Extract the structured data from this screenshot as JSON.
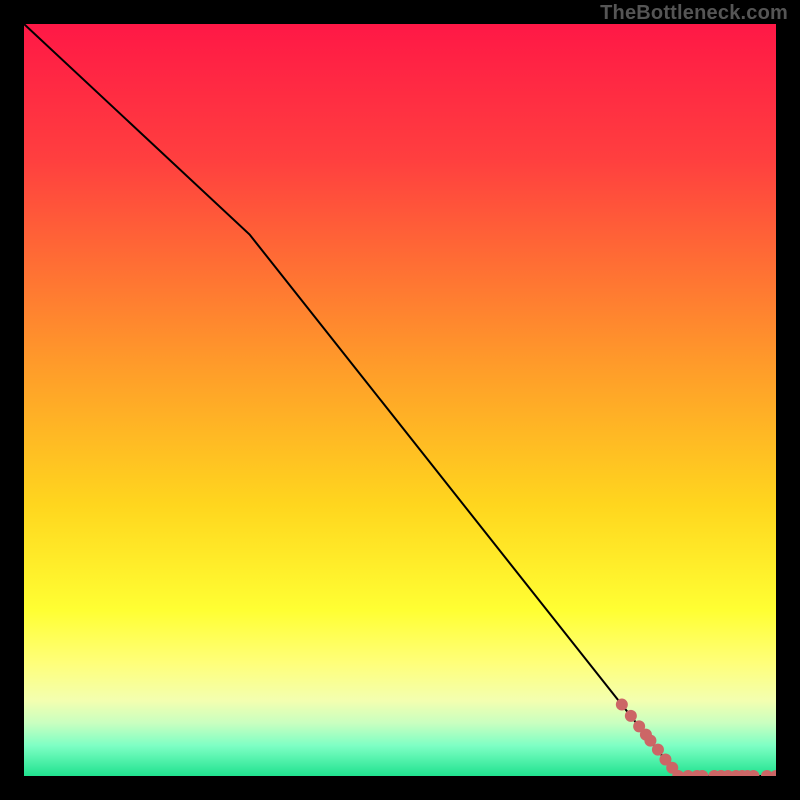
{
  "watermark": "TheBottleneck.com",
  "chart_data": {
    "type": "line",
    "title": "",
    "xlabel": "",
    "ylabel": "",
    "xlim": [
      0,
      100
    ],
    "ylim": [
      0,
      100
    ],
    "grid": false,
    "legend": false,
    "series": [
      {
        "name": "curve",
        "kind": "line",
        "x": [
          0,
          30,
          87,
          100
        ],
        "y": [
          100,
          72,
          0,
          0
        ]
      },
      {
        "name": "points",
        "kind": "scatter",
        "x": [
          79.5,
          80.7,
          81.8,
          82.7,
          83.3,
          84.3,
          85.3,
          86.2,
          87.0,
          88.3,
          89.5,
          90.2,
          91.8,
          92.7,
          93.6,
          94.7,
          95.5,
          96.2,
          97.0,
          98.8,
          100.0
        ],
        "y": [
          9.5,
          8.0,
          6.6,
          5.5,
          4.7,
          3.5,
          2.2,
          1.1,
          0.0,
          0.0,
          0.0,
          0.0,
          0.0,
          0.0,
          0.0,
          0.0,
          0.0,
          0.0,
          0.0,
          0.0,
          0.0
        ]
      }
    ],
    "background": {
      "type": "vertical-gradient-with-green-bands",
      "stops_pct": [
        {
          "at": 0,
          "color": "#ff1846"
        },
        {
          "at": 18,
          "color": "#ff3f3f"
        },
        {
          "at": 45,
          "color": "#ff9a2a"
        },
        {
          "at": 64,
          "color": "#ffd61e"
        },
        {
          "at": 78,
          "color": "#ffff33"
        },
        {
          "at": 85,
          "color": "#ffff7a"
        },
        {
          "at": 90,
          "color": "#f3ffb0"
        },
        {
          "at": 93,
          "color": "#c8ffc0"
        },
        {
          "at": 96,
          "color": "#7dffc4"
        },
        {
          "at": 100,
          "color": "#20e28f"
        }
      ]
    },
    "colors": {
      "line": "#000000",
      "point_fill": "#cc6666",
      "point_stroke": "#cc6666"
    }
  }
}
